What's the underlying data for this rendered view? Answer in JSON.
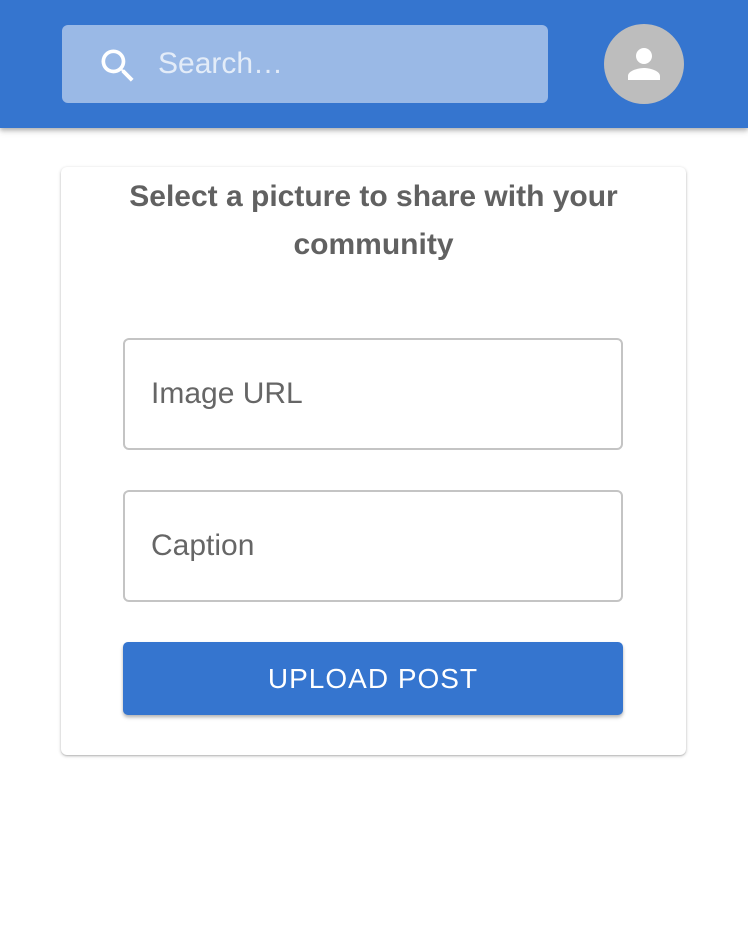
{
  "header": {
    "search": {
      "placeholder": "Search…",
      "value": "",
      "icon": "search-icon"
    },
    "avatar": {
      "icon": "person-icon"
    }
  },
  "form": {
    "title": "Select a picture to share with your community",
    "image_url": {
      "placeholder": "Image URL",
      "value": ""
    },
    "caption": {
      "placeholder": "Caption",
      "value": ""
    },
    "submit_label": "UPLOAD POST"
  },
  "colors": {
    "primary": "#3575cf",
    "search_background": "#9ab9e6",
    "avatar_background": "#bdbdbd"
  }
}
